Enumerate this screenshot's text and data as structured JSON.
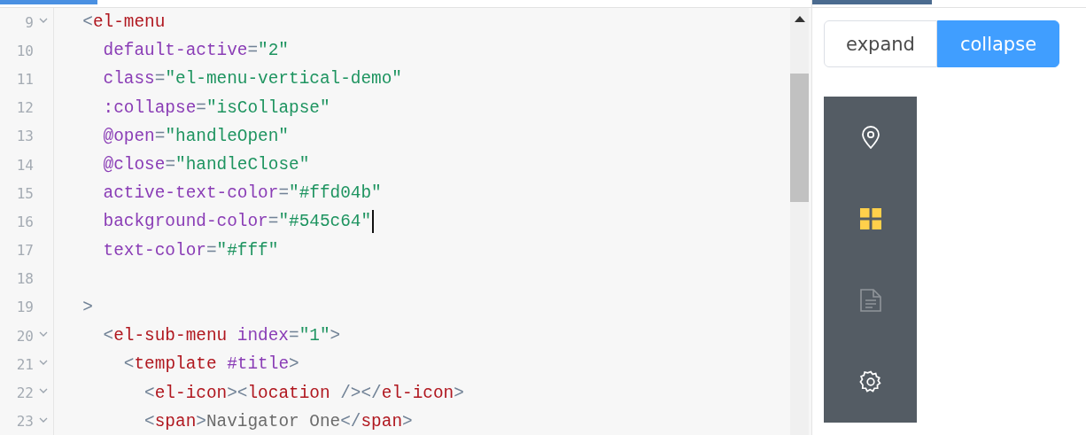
{
  "editor": {
    "lines": [
      {
        "number": "9",
        "foldable": true,
        "tokens": [
          {
            "kind": "punct",
            "text": "  <"
          },
          {
            "kind": "tag",
            "text": "el-menu"
          }
        ]
      },
      {
        "number": "10",
        "foldable": false,
        "tokens": [
          {
            "kind": "attr",
            "text": "    default-active"
          },
          {
            "kind": "punct",
            "text": "="
          },
          {
            "kind": "string",
            "text": "\"2\""
          }
        ]
      },
      {
        "number": "11",
        "foldable": false,
        "tokens": [
          {
            "kind": "attr",
            "text": "    class"
          },
          {
            "kind": "punct",
            "text": "="
          },
          {
            "kind": "string",
            "text": "\"el-menu-vertical-demo\""
          }
        ]
      },
      {
        "number": "12",
        "foldable": false,
        "tokens": [
          {
            "kind": "attr",
            "text": "    :collapse"
          },
          {
            "kind": "punct",
            "text": "="
          },
          {
            "kind": "string",
            "text": "\"isCollapse\""
          }
        ]
      },
      {
        "number": "13",
        "foldable": false,
        "tokens": [
          {
            "kind": "attr",
            "text": "    @open"
          },
          {
            "kind": "punct",
            "text": "="
          },
          {
            "kind": "string",
            "text": "\"handleOpen\""
          }
        ]
      },
      {
        "number": "14",
        "foldable": false,
        "tokens": [
          {
            "kind": "attr",
            "text": "    @close"
          },
          {
            "kind": "punct",
            "text": "="
          },
          {
            "kind": "string",
            "text": "\"handleClose\""
          }
        ]
      },
      {
        "number": "15",
        "foldable": false,
        "tokens": [
          {
            "kind": "attr",
            "text": "    active-text-color"
          },
          {
            "kind": "punct",
            "text": "="
          },
          {
            "kind": "string",
            "text": "\"#ffd04b\""
          }
        ]
      },
      {
        "number": "16",
        "foldable": false,
        "cursor": true,
        "tokens": [
          {
            "kind": "attr",
            "text": "    background-color"
          },
          {
            "kind": "punct",
            "text": "="
          },
          {
            "kind": "string",
            "text": "\"#545c64\""
          }
        ]
      },
      {
        "number": "17",
        "foldable": false,
        "tokens": [
          {
            "kind": "attr",
            "text": "    text-color"
          },
          {
            "kind": "punct",
            "text": "="
          },
          {
            "kind": "string",
            "text": "\"#fff\""
          }
        ]
      },
      {
        "number": "18",
        "foldable": false
      },
      {
        "number": "19",
        "foldable": false,
        "tokens": [
          {
            "kind": "punct",
            "text": "  >"
          }
        ]
      },
      {
        "number": "20",
        "foldable": true,
        "tokens": [
          {
            "kind": "punct",
            "text": "    <"
          },
          {
            "kind": "tag",
            "text": "el-sub-menu"
          },
          {
            "kind": "attr",
            "text": " index"
          },
          {
            "kind": "punct",
            "text": "="
          },
          {
            "kind": "string",
            "text": "\"1\""
          },
          {
            "kind": "punct",
            "text": ">"
          }
        ]
      },
      {
        "number": "21",
        "foldable": true,
        "tokens": [
          {
            "kind": "punct",
            "text": "      <"
          },
          {
            "kind": "tag",
            "text": "template"
          },
          {
            "kind": "attr",
            "text": " #title"
          },
          {
            "kind": "punct",
            "text": ">"
          }
        ]
      },
      {
        "number": "22",
        "foldable": true,
        "tokens": [
          {
            "kind": "punct",
            "text": "        <"
          },
          {
            "kind": "tag",
            "text": "el-icon"
          },
          {
            "kind": "punct",
            "text": "><"
          },
          {
            "kind": "tag",
            "text": "location"
          },
          {
            "kind": "punct",
            "text": " /></"
          },
          {
            "kind": "tag",
            "text": "el-icon"
          },
          {
            "kind": "punct",
            "text": ">"
          }
        ]
      },
      {
        "number": "23",
        "foldable": true,
        "tokens": [
          {
            "kind": "punct",
            "text": "        <"
          },
          {
            "kind": "tag",
            "text": "span"
          },
          {
            "kind": "punct",
            "text": ">"
          },
          {
            "kind": "text",
            "text": "Navigator One"
          },
          {
            "kind": "punct",
            "text": "</"
          },
          {
            "kind": "tag",
            "text": "span"
          },
          {
            "kind": "punct",
            "text": ">"
          }
        ]
      }
    ]
  },
  "toggle": [
    {
      "label": "expand",
      "selected": false
    },
    {
      "label": "collapse",
      "selected": true
    }
  ],
  "menu": {
    "items": [
      {
        "selected": false,
        "disabled": false
      },
      {
        "selected": true,
        "disabled": false
      },
      {
        "selected": false,
        "disabled": true
      },
      {
        "selected": false,
        "disabled": false
      }
    ]
  }
}
